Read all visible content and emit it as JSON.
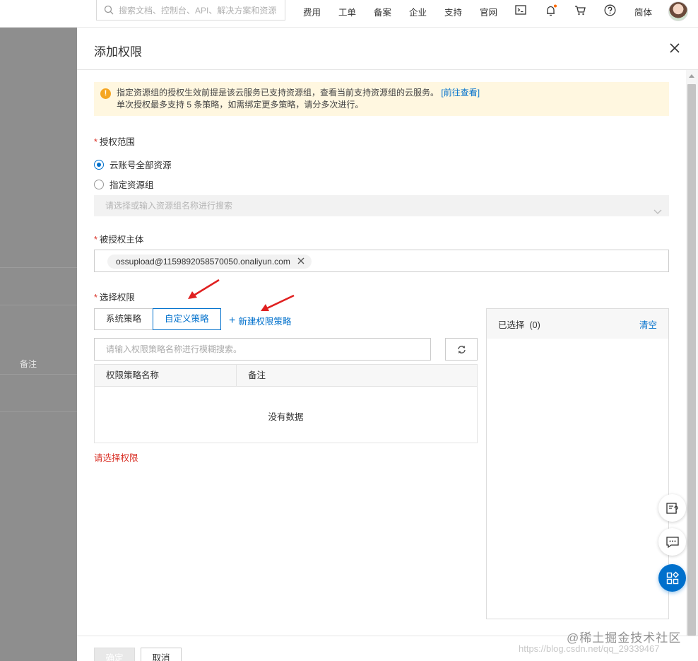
{
  "topbar": {
    "search_placeholder": "搜索文档、控制台、API、解决方案和资源",
    "nav": [
      "费用",
      "工单",
      "备案",
      "企业",
      "支持",
      "官网"
    ],
    "lang": "简体"
  },
  "background": {
    "remark_label": "备注"
  },
  "drawer": {
    "title": "添加权限",
    "notice": {
      "line1": "指定资源组的授权生效前提是该云服务已支持资源组，查看当前支持资源组的云服务。",
      "link": "[前往查看]",
      "line2": "单次授权最多支持 5 条策略，如需绑定更多策略，请分多次进行。"
    },
    "scope": {
      "label": "授权范围",
      "option_all": "云账号全部资源",
      "option_group": "指定资源组",
      "group_placeholder": "请选择或输入资源组名称进行搜索"
    },
    "principal": {
      "label": "被授权主体",
      "tag": "ossupload@1159892058570050.onaliyun.com"
    },
    "permissions": {
      "label": "选择权限",
      "tab_system": "系统策略",
      "tab_custom": "自定义策略",
      "new_policy": "新建权限策略",
      "search_placeholder": "请输入权限策略名称进行模糊搜索。",
      "columns": [
        "权限策略名称",
        "备注"
      ],
      "empty": "没有数据",
      "error": "请选择权限"
    },
    "selected": {
      "title": "已选择",
      "count": "(0)",
      "clear": "清空"
    },
    "footer": {
      "confirm": "确定",
      "cancel": "取消"
    }
  },
  "watermark": {
    "line1": "@稀土掘金技术社区",
    "line2": "https://blog.csdn.net/qq_29339467"
  },
  "colors": {
    "primary": "#0070cc",
    "error": "#d93026",
    "warning": "#f5a623",
    "annotation_arrow": "#e02020"
  }
}
